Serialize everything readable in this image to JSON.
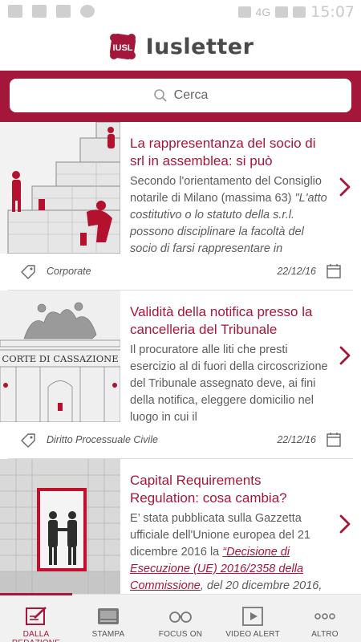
{
  "status_bar": {
    "time": "15:07",
    "signal": "4G"
  },
  "header": {
    "title": "Iusletter",
    "logo_text": "IUSL"
  },
  "search": {
    "placeholder": "Cerca"
  },
  "colors": {
    "brand": "#a5173a",
    "text": "#5c5c5c"
  },
  "articles": [
    {
      "title": "La rappresentanza del socio di srl in assemblea: si può",
      "excerpt_plain": "Secondo l'orientamento del Consiglio notarile di Milano (massima 63)",
      "excerpt_italic": "\"L'atto costitutivo o lo statuto della s.r.l. possono disciplinare la facoltà del socio di farsi rappresentare in",
      "category": "Corporate",
      "date": "22/12/16",
      "image": "statue-steps-illustration"
    },
    {
      "title": "Validità della notifica presso la cancelleria del Tribunale",
      "excerpt_plain": "Il procuratore alle liti che presti esercizio al di fuori della circoscrizione del Tribunale assegnato deve, ai fini della notifica, eleggere domicilio nel luogo in cui il",
      "category": "Diritto Processuale Civile",
      "date": "22/12/16",
      "image": "corte-di-cassazione-sketch",
      "image_caption": "CORTE DI CASSAZIONE"
    },
    {
      "title": "Capital Requirements Regulation: cosa cambia?",
      "excerpt_plain": "E’ stata pubblicata sulla Gazzetta ufficiale dell'Unione europea del 21 dicembre 2016 la ",
      "excerpt_link": "“Decisione di Esecuzione (UE) 2016/2358 della Commissione",
      "excerpt_tail": ", del 20 dicembre 2016,",
      "image": "handshake-doorway"
    }
  ],
  "bottom_nav": [
    {
      "label": "DALLA REDAZIONE",
      "icon": "newspaper-pen-icon",
      "active": true
    },
    {
      "label": "STAMPA",
      "icon": "press-icon",
      "active": false
    },
    {
      "label": "FOCUS ON",
      "icon": "glasses-icon",
      "active": false
    },
    {
      "label": "VIDEO ALERT",
      "icon": "play-icon",
      "active": false
    },
    {
      "label": "ALTRO",
      "icon": "more-dots-icon",
      "active": false
    }
  ]
}
